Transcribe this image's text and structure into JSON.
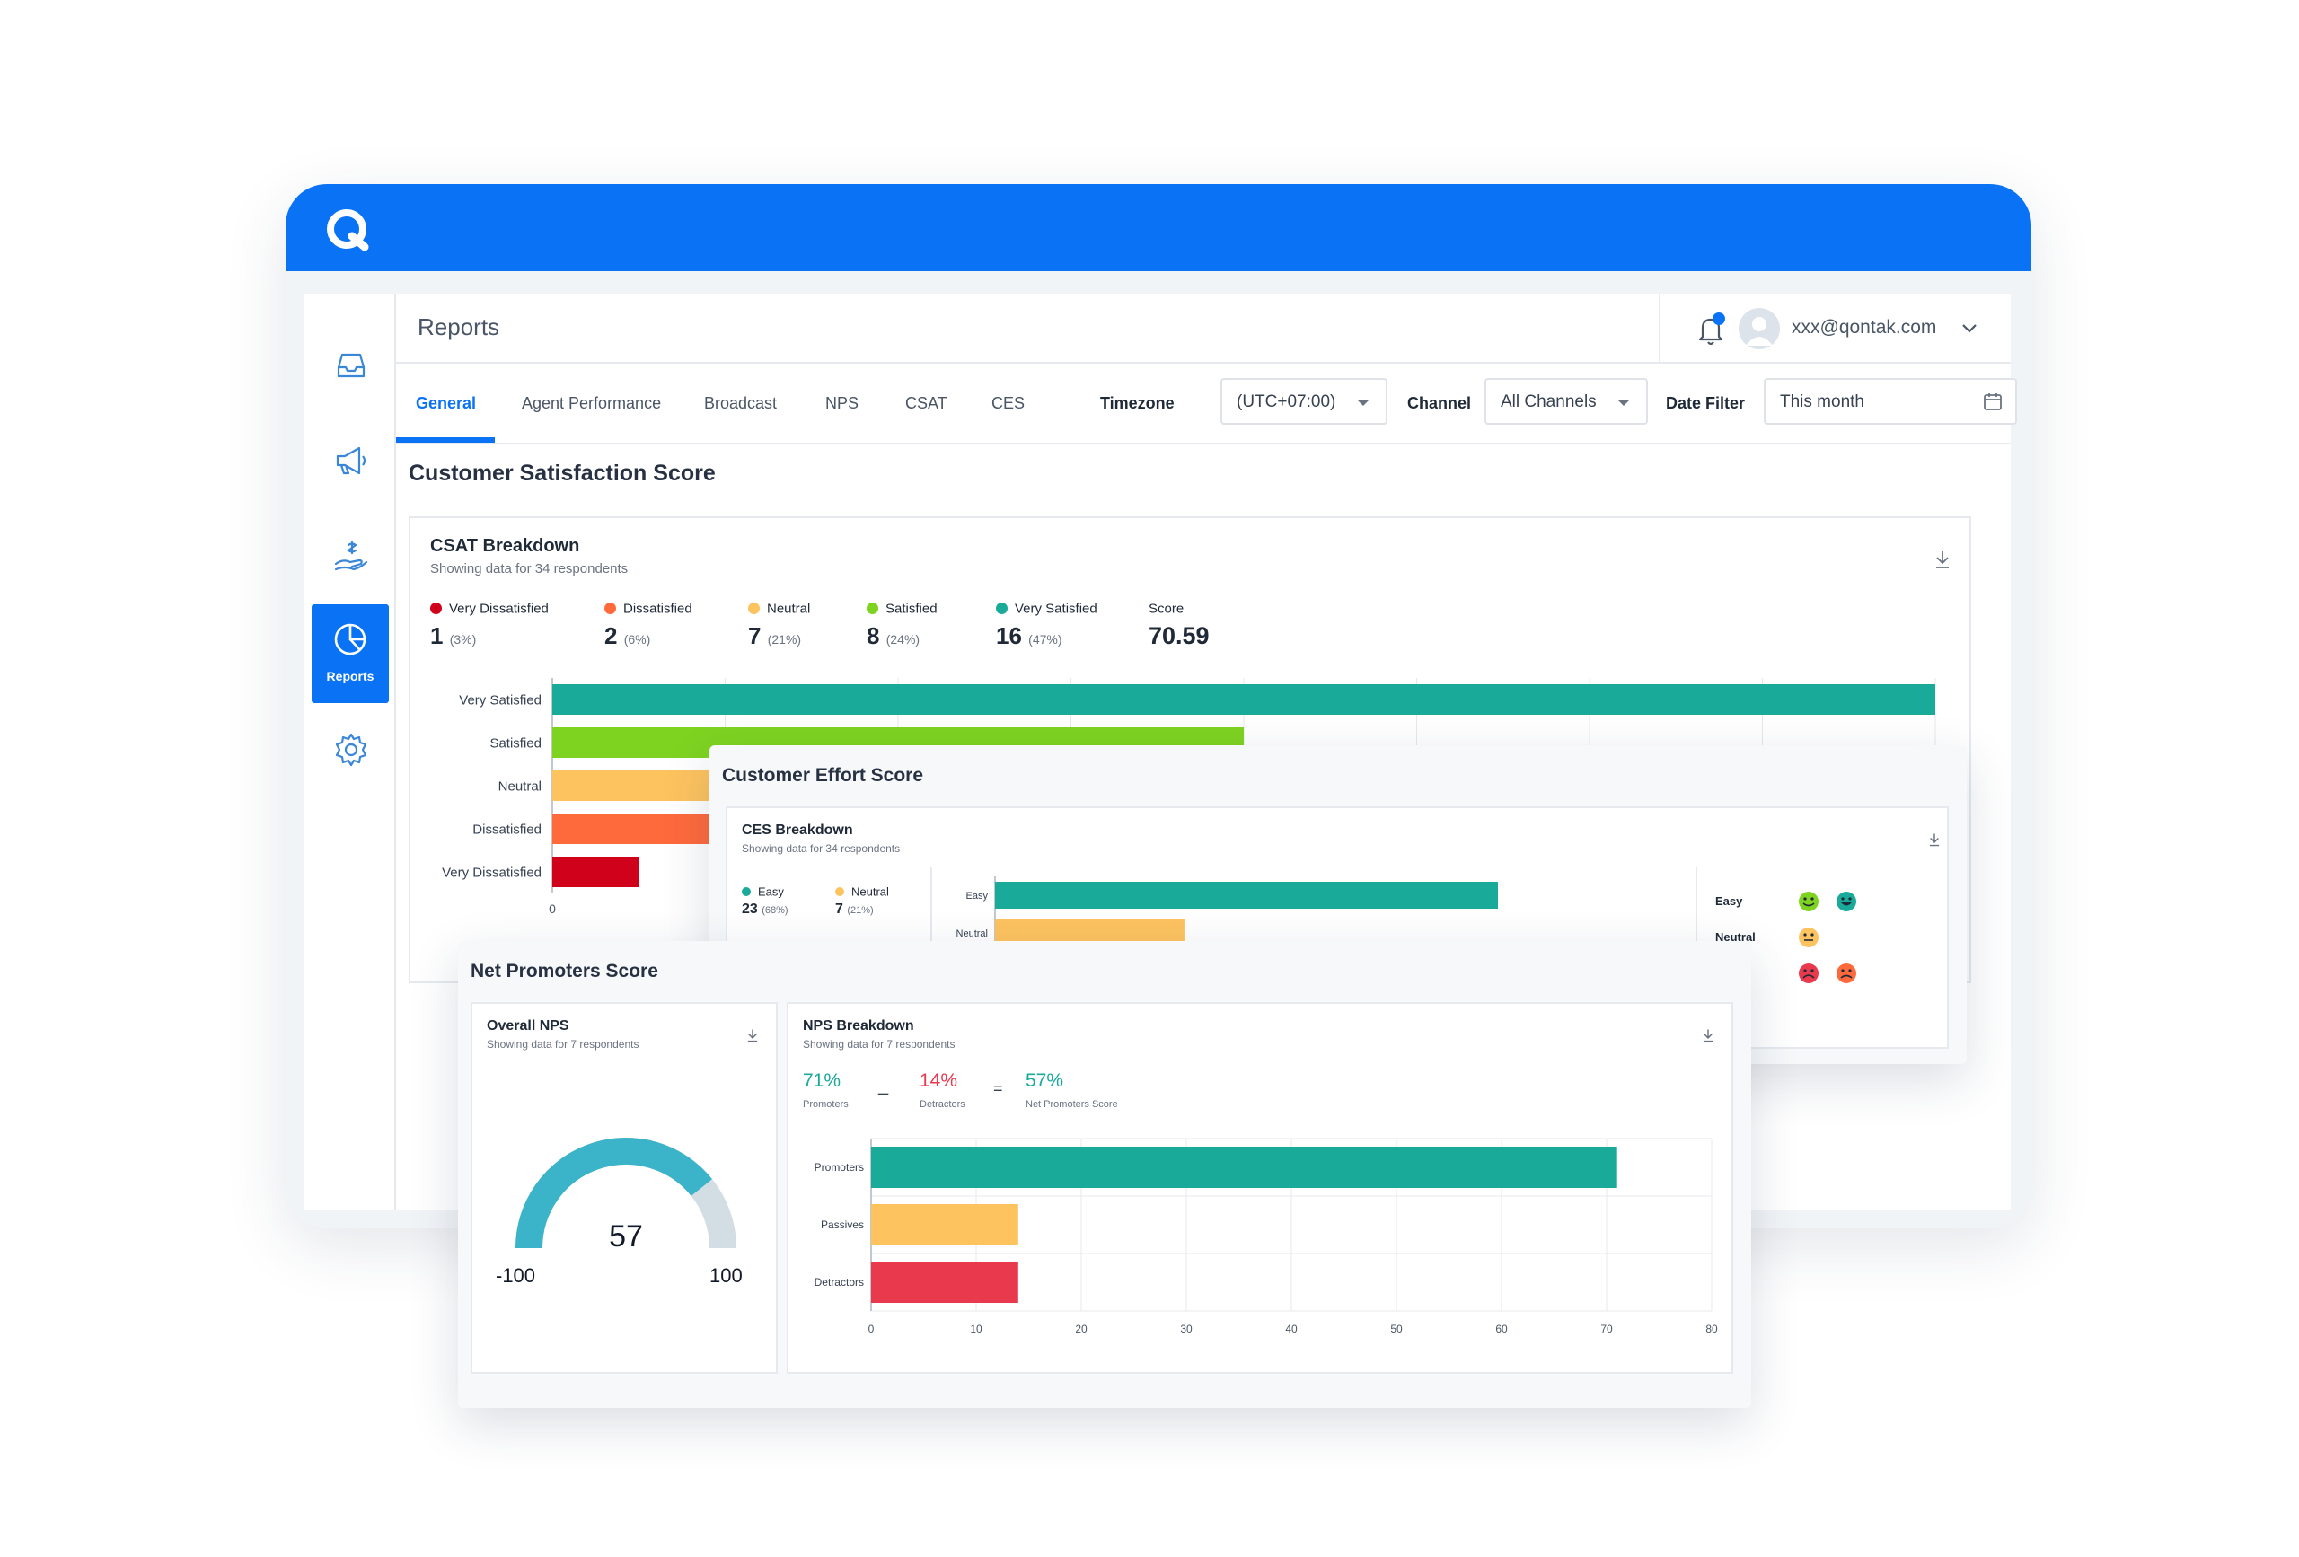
{
  "app": {
    "brand_color": "#0a73f5",
    "page_title": "Reports",
    "user_email": "xxx@qontak.com"
  },
  "sidebar": {
    "items": [
      {
        "icon": "inbox-icon"
      },
      {
        "icon": "megaphone-icon"
      },
      {
        "icon": "hand-coin-icon"
      },
      {
        "icon": "pie-chart-icon",
        "label": "Reports",
        "active": true
      },
      {
        "icon": "gear-icon"
      }
    ]
  },
  "tabs": [
    "General",
    "Agent Performance",
    "Broadcast",
    "NPS",
    "CSAT",
    "CES"
  ],
  "filters": {
    "timezone_label": "Timezone",
    "timezone_value": "(UTC+07:00)",
    "channel_label": "Channel",
    "channel_value": "All Channels",
    "date_label": "Date Filter",
    "date_value": "This month"
  },
  "csat": {
    "section_title": "Customer Satisfaction Score",
    "card_title": "CSAT Breakdown",
    "card_sub": "Showing data for 34 respondents",
    "legend": [
      {
        "label": "Very Dissatisfied",
        "count": "1",
        "pct": "(3%)",
        "color": "#d0021b"
      },
      {
        "label": "Dissatisfied",
        "count": "2",
        "pct": "(6%)",
        "color": "#ff6a3d"
      },
      {
        "label": "Neutral",
        "count": "7",
        "pct": "(21%)",
        "color": "#fdc35f"
      },
      {
        "label": "Satisfied",
        "count": "8",
        "pct": "(24%)",
        "color": "#7ed321"
      },
      {
        "label": "Very Satisfied",
        "count": "16",
        "pct": "(47%)",
        "color": "#1aaa9a"
      }
    ],
    "score_label": "Score",
    "score_value": "70.59",
    "axis_zero": "0"
  },
  "ces": {
    "section_title": "Customer Effort Score",
    "card_title": "CES Breakdown",
    "card_sub": "Showing data for 34 respondents",
    "legend": [
      {
        "label": "Easy",
        "count": "23",
        "pct": "(68%)",
        "color": "#1aaa9a"
      },
      {
        "label": "Neutral",
        "count": "7",
        "pct": "(21%)",
        "color": "#fdc35f"
      }
    ],
    "emoji_rows": [
      {
        "label": "Easy",
        "faces": [
          "#7ed321",
          "#1aaa9a"
        ]
      },
      {
        "label": "Neutral",
        "faces": [
          "#fdc35f"
        ]
      },
      {
        "label": "",
        "faces": [
          "#d0021b",
          "#ff6a3d"
        ]
      }
    ]
  },
  "nps": {
    "section_title": "Net Promoters Score",
    "overall_title": "Overall NPS",
    "overall_sub": "Showing data for 7 respondents",
    "gauge_value": "57",
    "gauge_min": "-100",
    "gauge_max": "100",
    "gauge_color": "#3bb3c8",
    "gauge_track": "#d3dde4",
    "breakdown_title": "NPS Breakdown",
    "breakdown_sub": "Showing data for 7 respondents",
    "promoters_pct": "71%",
    "promoters_label": "Promoters",
    "minus": "_",
    "detractors_pct": "14%",
    "detractors_label": "Detractors",
    "equals": "=",
    "nps_pct": "57%",
    "nps_label": "Net Promoters Score"
  },
  "chart_data": [
    {
      "type": "bar",
      "orientation": "horizontal",
      "categories": [
        "Very Satisfied",
        "Satisfied",
        "Neutral",
        "Dissatisfied",
        "Very Dissatisfied"
      ],
      "values": [
        16,
        8,
        7,
        2,
        1
      ],
      "colors": [
        "#1aaa9a",
        "#7ed321",
        "#fdc35f",
        "#ff6a3d",
        "#d0021b"
      ],
      "xlim": [
        0,
        16
      ]
    },
    {
      "type": "bar",
      "orientation": "horizontal",
      "categories": [
        "Easy",
        "Neutral"
      ],
      "values": [
        23,
        7
      ],
      "colors": [
        "#1aaa9a",
        "#fdc35f"
      ],
      "xlim": [
        0,
        23
      ]
    },
    {
      "type": "bar",
      "orientation": "horizontal",
      "categories": [
        "Promoters",
        "Passives",
        "Detractors"
      ],
      "values": [
        71,
        14,
        14
      ],
      "colors": [
        "#1aaa9a",
        "#fdc35f",
        "#e8394d"
      ],
      "xlim": [
        0,
        80
      ],
      "xticks": [
        "0",
        "10",
        "20",
        "30",
        "40",
        "50",
        "60",
        "70",
        "80"
      ],
      "grid": true
    }
  ]
}
